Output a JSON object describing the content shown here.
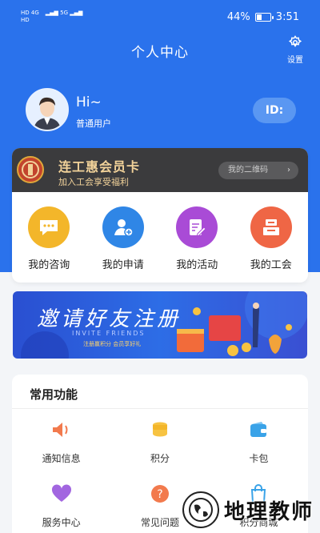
{
  "status": {
    "left_top": "HD 4G",
    "left_bottom": "HD",
    "signal_b": "5G",
    "battery_pct": "44%",
    "battery_level": 0.44,
    "time": "3:51"
  },
  "header": {
    "title": "个人中心",
    "settings_label": "设置"
  },
  "profile": {
    "greeting": "Hi~",
    "user_type": "普通用户",
    "id_label": "ID:"
  },
  "member_card": {
    "title": "连工惠会员卡",
    "subtitle": "加入工会享受福利",
    "qr_label": "我的二维码",
    "qr_chevron": "›"
  },
  "quick_actions": [
    {
      "label": "我的咨询",
      "icon": "chat-bubble-icon",
      "color": "#f3b62a"
    },
    {
      "label": "我的申请",
      "icon": "user-add-icon",
      "color": "#2f86e6"
    },
    {
      "label": "我的活动",
      "icon": "edit-note-icon",
      "color": "#a94bd6"
    },
    {
      "label": "我的工会",
      "icon": "union-building-icon",
      "color": "#ef6645"
    }
  ],
  "banner": {
    "title": "邀请好友注册",
    "subtitle": "INVITE FRIENDS",
    "note": "注册赢积分 会员享好礼"
  },
  "functions": {
    "title": "常用功能",
    "items": [
      {
        "label": "通知信息",
        "icon": "speaker-icon",
        "color": "#f27a4d"
      },
      {
        "label": "积分",
        "icon": "coin-stack-icon",
        "color": "#f3b62a"
      },
      {
        "label": "卡包",
        "icon": "wallet-icon",
        "color": "#3aa3e8"
      },
      {
        "label": "服务中心",
        "icon": "heart-icon",
        "color": "#a266e0"
      },
      {
        "label": "常见问题",
        "icon": "question-icon",
        "color": "#f27a4d"
      },
      {
        "label": "积分商城",
        "icon": "shopping-bag-icon",
        "color": "#3aa3e8"
      }
    ]
  },
  "watermark": {
    "text": "地理教师"
  }
}
